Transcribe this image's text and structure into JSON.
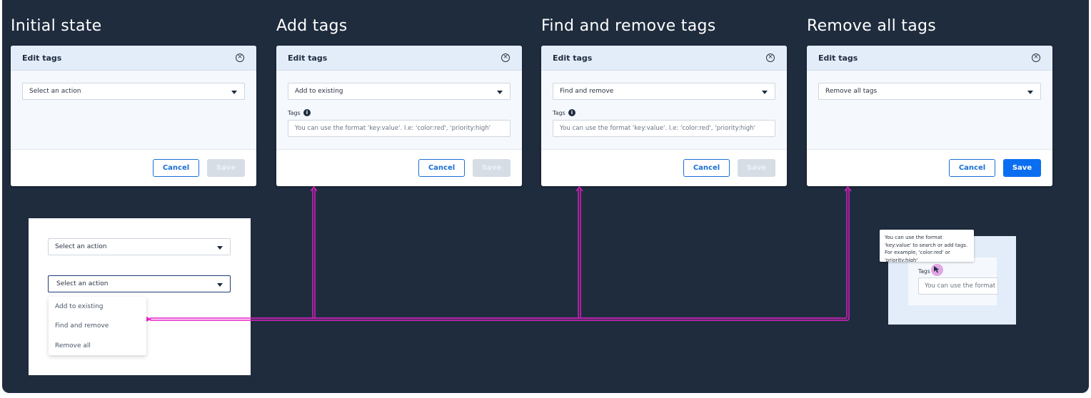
{
  "columns": [
    {
      "title": "Initial state",
      "dialog": {
        "title": "Edit tags",
        "select_value": "Select an action",
        "show_tags": false,
        "cancel_label": "Cancel",
        "save_label": "Save",
        "save_enabled": false
      }
    },
    {
      "title": "Add tags",
      "dialog": {
        "title": "Edit tags",
        "select_value": "Add to existing",
        "show_tags": true,
        "tags_label": "Tags",
        "tags_placeholder": "You can use the format 'key:value'. I.e: 'color:red', 'priority:high'",
        "cancel_label": "Cancel",
        "save_label": "Save",
        "save_enabled": false
      }
    },
    {
      "title": "Find and remove tags",
      "dialog": {
        "title": "Edit tags",
        "select_value": "Find and remove",
        "show_tags": true,
        "tags_label": "Tags",
        "tags_placeholder": "You can use the format 'key:value'. I.e: 'color:red', 'priority:high'",
        "cancel_label": "Cancel",
        "save_label": "Save",
        "save_enabled": false
      }
    },
    {
      "title": "Remove all tags",
      "dialog": {
        "title": "Edit tags",
        "select_value": "Remove all tags",
        "show_tags": false,
        "cancel_label": "Cancel",
        "save_label": "Save",
        "save_enabled": true
      }
    }
  ],
  "dropdown_example": {
    "closed_value": "Select an action",
    "open_value": "Select an action",
    "options": [
      "Add to existing",
      "Find and remove",
      "Remove all"
    ]
  },
  "tooltip_example": {
    "tooltip_text": "You can use the format 'key:value' to search or add tags. For example, 'color:red' or 'priority:high'",
    "tags_label": "Tags",
    "input_placeholder": "You can use the format"
  },
  "colors": {
    "background": "#1f2c3e",
    "connector": "#e61ec8",
    "primary": "#0b6ef0",
    "disabled": "#d6dde5"
  }
}
